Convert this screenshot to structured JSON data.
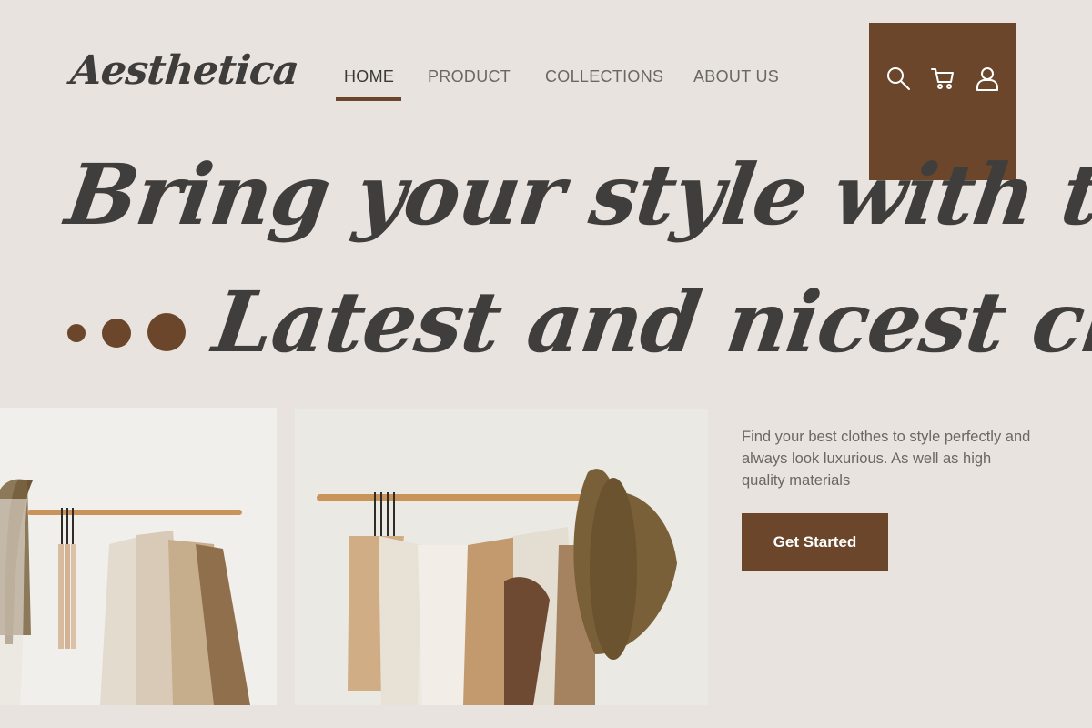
{
  "brand": {
    "logo": "Aesthetica"
  },
  "nav": {
    "items": [
      {
        "label": "HOME",
        "active": true
      },
      {
        "label": "PRODUCT"
      },
      {
        "label": "COLLECTIONS"
      },
      {
        "label": "ABOUT US"
      }
    ]
  },
  "header_icons": [
    "search-icon",
    "cart-icon",
    "user-icon"
  ],
  "hero": {
    "line1": "Bring your style with the",
    "line2": "Latest and nicest clothes"
  },
  "content": {
    "description": "Find your best clothes to style perfectly and always look luxurious. As well as high quality materials",
    "cta_label": "Get Started"
  },
  "colors": {
    "accent": "#6b462b",
    "background": "#e8e3de",
    "text": "#3f3d3b"
  }
}
